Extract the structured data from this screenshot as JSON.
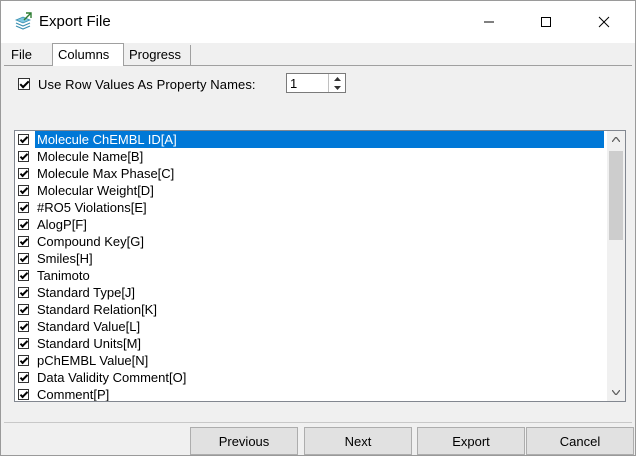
{
  "window": {
    "title": "Export File"
  },
  "tabs": {
    "file": "File",
    "columns": "Columns",
    "progress": "Progress"
  },
  "options": {
    "use_row_values_label": "Use Row Values As Property Names:",
    "use_row_values_checked": true,
    "row_value": "1"
  },
  "columns": [
    "Molecule ChEMBL ID[A]",
    "Molecule Name[B]",
    "Molecule Max Phase[C]",
    "Molecular Weight[D]",
    "#RO5 Violations[E]",
    "AlogP[F]",
    "Compound Key[G]",
    "Smiles[H]",
    "Tanimoto",
    "Standard Type[J]",
    "Standard Relation[K]",
    "Standard Value[L]",
    "Standard Units[M]",
    "pChEMBL Value[N]",
    "Data Validity Comment[O]",
    "Comment[P]"
  ],
  "selected_index": 0,
  "buttons": {
    "previous": "Previous",
    "next": "Next",
    "export": "Export",
    "cancel": "Cancel"
  },
  "colors": {
    "selection": "#0078d7",
    "accent_icon": "#3aa0c8"
  }
}
